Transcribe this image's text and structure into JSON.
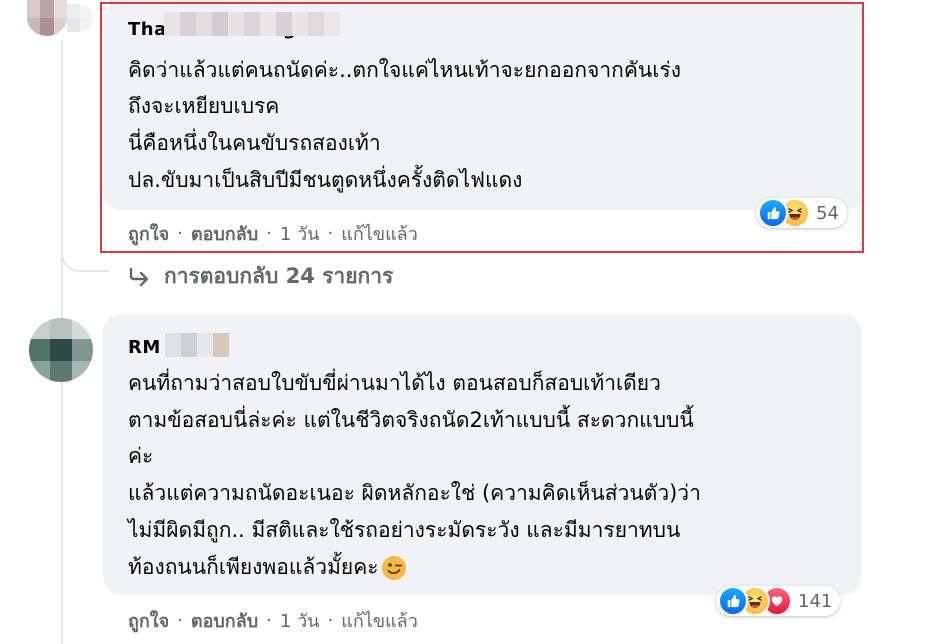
{
  "comments": [
    {
      "author": "Thanarat Thongbai",
      "lines": [
        "คิดว่าแล้วแต่คนถนัดค่ะ..ตกใจแค่ไหนเท้าจะยกออกจากคันเร่ง",
        "ถึงจะเหยียบเบรค",
        "นี่คือหนึ่งในคนขับรถสองเท้า",
        "ปล.ขับมาเป็นสิบปีมีชนตูดหนึ่งครั้งติดไฟแดง"
      ],
      "reaction_count": "54",
      "reaction_icons": [
        "like-icon",
        "haha-icon"
      ],
      "actions": {
        "like": "ถูกใจ",
        "reply": "ตอบกลับ",
        "time": "1 วัน",
        "edited": "แก้ไขแล้ว",
        "separator": "·"
      }
    },
    {
      "author": "RM",
      "lines": [
        "คนที่ถามว่าสอบใบขับขี่ผ่านมาได้ไง ตอนสอบก็สอบเท้าเดียว",
        "ตามข้อสอบนี่ล่ะค่ะ แต่ในชีวิตจริงถนัด2เท้าแบบนี้ สะดวกแบบนี้",
        "ค่ะ",
        "แล้วแต่ความถนัดอะเนอะ ผิดหลักอะใช่ (ความคิดเห็นส่วนตัว)ว่า",
        "ไม่มีผิดมีถูก.. มีสติและใช้รถอย่างระมัดระวัง และมีมารยาทบน",
        "ท้องถนนก็เพียงพอแล้วมั้ยคะ"
      ],
      "reaction_count": "141",
      "reaction_icons": [
        "like-icon",
        "haha-icon",
        "love-icon"
      ],
      "actions": {
        "like": "ถูกใจ",
        "reply": "ตอบกลับ",
        "time": "1 วัน",
        "edited": "แก้ไขแล้ว",
        "separator": "·"
      }
    }
  ],
  "replies_link": {
    "label": "การตอบกลับ 24 รายการ",
    "icon": "reply-arrow-icon"
  },
  "colors": {
    "bubble": "#f0f2f5",
    "meta_text": "#65676b",
    "highlight": "#e5383c",
    "like": "#0866ff",
    "love": "#e61739",
    "haha": "#f7b125"
  }
}
